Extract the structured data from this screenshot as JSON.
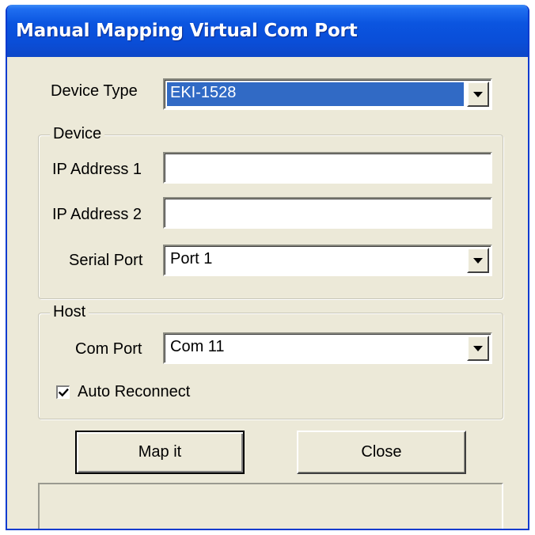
{
  "window": {
    "title": "Manual Mapping Virtual Com Port"
  },
  "device_type": {
    "label": "Device Type",
    "selected": "EKI-1528"
  },
  "device_group": {
    "title": "Device",
    "ip_address_1": {
      "label": "IP Address 1",
      "value": ""
    },
    "ip_address_2": {
      "label": "IP Address 2",
      "value": ""
    },
    "serial_port": {
      "label": "Serial Port",
      "selected": "Port 1"
    }
  },
  "host_group": {
    "title": "Host",
    "com_port": {
      "label": "Com Port",
      "selected": "Com 11"
    },
    "auto_reconnect": {
      "label": "Auto Reconnect",
      "checked": true
    }
  },
  "buttons": {
    "map_it": "Map it",
    "close": "Close"
  },
  "status": {
    "text": ""
  },
  "icons": {
    "dropdown": "chevron-down-icon",
    "check": "checkmark-icon"
  },
  "colors": {
    "titlebar": "#0a4ed8",
    "selection": "#316ac5",
    "window_bg": "#ece9d8"
  }
}
